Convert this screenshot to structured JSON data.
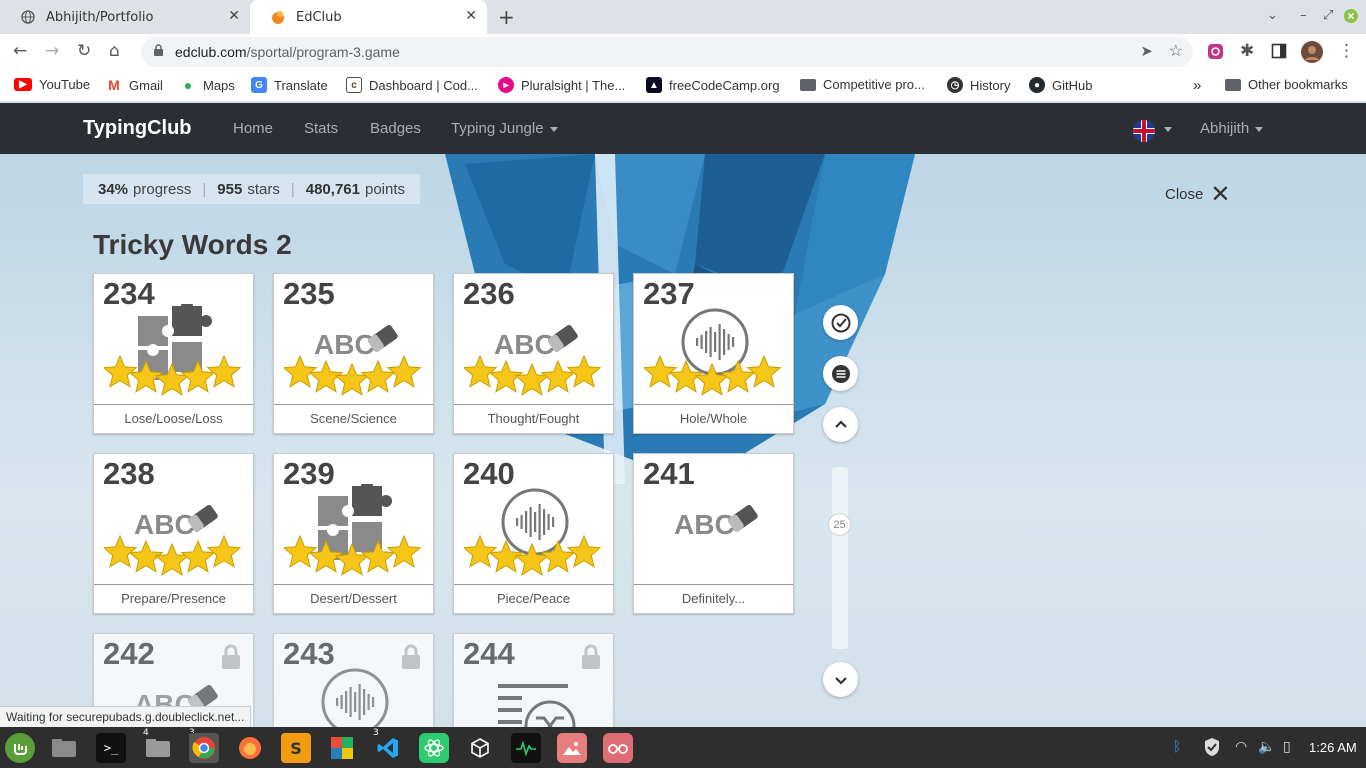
{
  "browser": {
    "tabs": [
      {
        "title": "Abhijith/Portfolio"
      },
      {
        "title": "EdClub"
      }
    ],
    "url_host": "edclub.com",
    "url_path": "/sportal/program-3.game",
    "bookmarks": [
      {
        "label": "YouTube",
        "icon": "youtube-icon",
        "color": "#ff0000"
      },
      {
        "label": "Gmail",
        "icon": "gmail-icon",
        "color": "#ea4335"
      },
      {
        "label": "Maps",
        "icon": "maps-icon",
        "color": "#34a853"
      },
      {
        "label": "Translate",
        "icon": "translate-icon",
        "color": "#4285f4"
      },
      {
        "label": "Dashboard | Cod...",
        "icon": "codechef-icon",
        "color": "#5b4638"
      },
      {
        "label": "Pluralsight | The...",
        "icon": "pluralsight-icon",
        "color": "#e80a89"
      },
      {
        "label": "freeCodeCamp.org",
        "icon": "freecodecamp-icon",
        "color": "#0a0a23"
      },
      {
        "label": "Competitive pro...",
        "icon": "folder-icon",
        "color": "#5f6368"
      },
      {
        "label": "History",
        "icon": "history-icon",
        "color": "#333333"
      },
      {
        "label": "GitHub",
        "icon": "github-icon",
        "color": "#24292e"
      }
    ],
    "other_bookmarks": "Other bookmarks",
    "status_text": "Waiting for securepubads.g.doubleclick.net..."
  },
  "site": {
    "brand": "TypingClub",
    "nav": [
      "Home",
      "Stats",
      "Badges"
    ],
    "jungle": "Typing Jungle",
    "user": "Abhijith",
    "language_flag": "uk-flag-icon"
  },
  "stats": {
    "progress": "34%",
    "progress_label": "progress",
    "stars": "955",
    "stars_label": "stars",
    "points": "480,761",
    "points_label": "points"
  },
  "close_label": "Close",
  "section_title": "Tricky Words 2",
  "lessons": [
    {
      "num": "234",
      "label": "Lose/Loose/Loss",
      "icon": "puzzle",
      "stars": 5,
      "locked": false
    },
    {
      "num": "235",
      "label": "Scene/Science",
      "icon": "abc",
      "stars": 5,
      "locked": false
    },
    {
      "num": "236",
      "label": "Thought/Fought",
      "icon": "abc",
      "stars": 5,
      "locked": false
    },
    {
      "num": "237",
      "label": "Hole/Whole",
      "icon": "audio",
      "stars": 5,
      "locked": false
    },
    {
      "num": "238",
      "label": "Prepare/Presence",
      "icon": "abc",
      "stars": 5,
      "locked": false
    },
    {
      "num": "239",
      "label": "Desert/Dessert",
      "icon": "puzzle",
      "stars": 5,
      "locked": false
    },
    {
      "num": "240",
      "label": "Piece/Peace",
      "icon": "audio",
      "stars": 5,
      "locked": false
    },
    {
      "num": "241",
      "label": "Definitely...",
      "icon": "abc",
      "stars": 0,
      "locked": false
    },
    {
      "num": "242",
      "label": "",
      "icon": "abc",
      "stars": 0,
      "locked": true
    },
    {
      "num": "243",
      "label": "",
      "icon": "audio",
      "stars": 0,
      "locked": true
    },
    {
      "num": "244",
      "label": "",
      "icon": "shuffle",
      "stars": 0,
      "locked": true
    }
  ],
  "abc_text": "ABC",
  "page_badge": "25",
  "clock": "1:26 AM",
  "taskbar_counts": {
    "files": "4",
    "chrome": "3",
    "vscode": "3"
  },
  "colors": {
    "nav_bg": "#2b2f33",
    "star": "#f5c518",
    "icon_grey": "#8a8a8a"
  }
}
